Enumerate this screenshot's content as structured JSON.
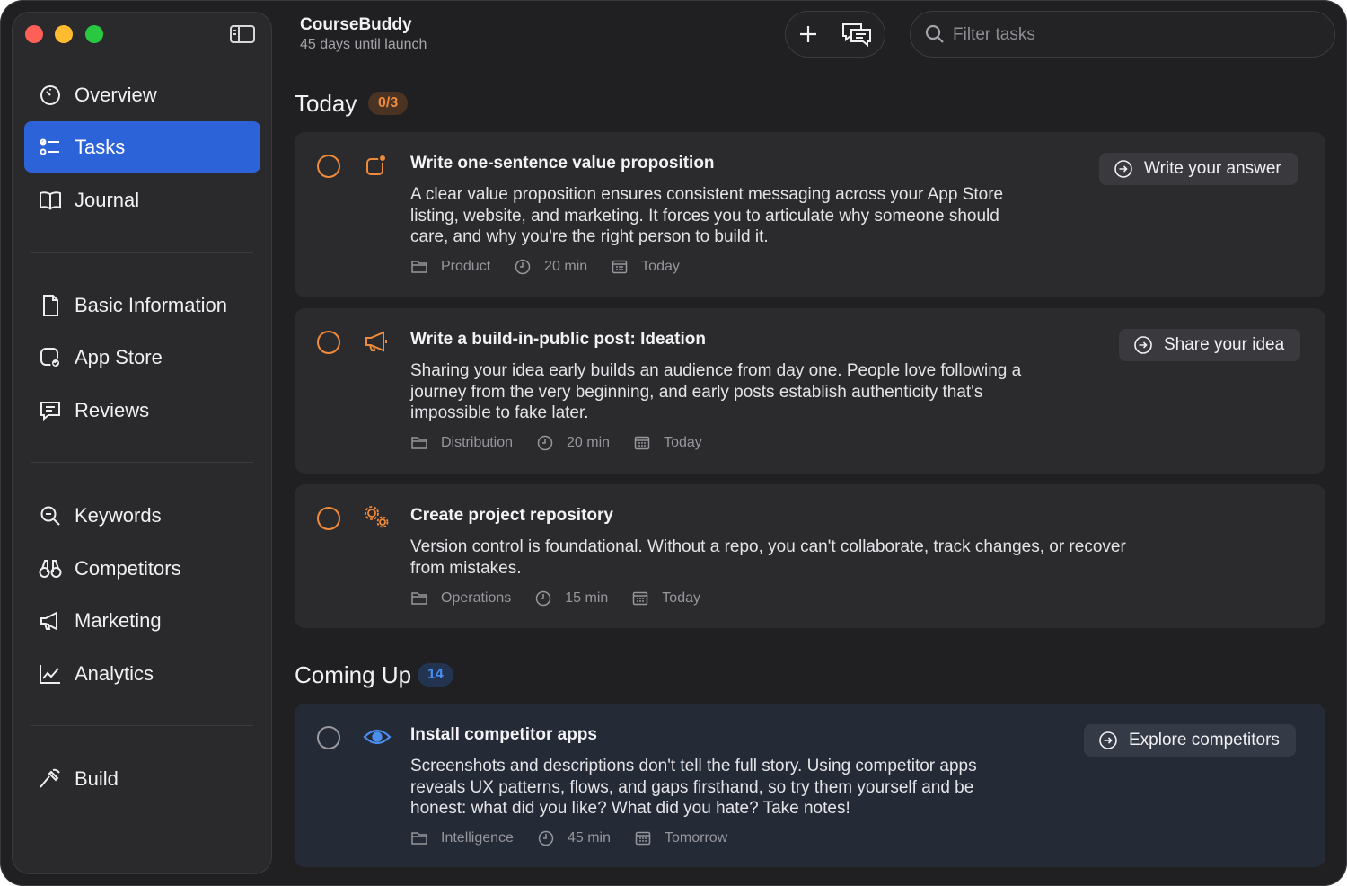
{
  "app": {
    "title": "CourseBuddy",
    "subtitle": "45 days until launch"
  },
  "search": {
    "placeholder": "Filter tasks"
  },
  "sidebar": {
    "items": [
      {
        "label": "Overview",
        "icon": "gauge-icon",
        "active": false
      },
      {
        "label": "Tasks",
        "icon": "checklist-icon",
        "active": true
      },
      {
        "label": "Journal",
        "icon": "book-icon",
        "active": false
      },
      {
        "label": "Basic Information",
        "icon": "document-icon",
        "active": false
      },
      {
        "label": "App Store",
        "icon": "app-store-icon",
        "active": false
      },
      {
        "label": "Reviews",
        "icon": "message-icon",
        "active": false
      },
      {
        "label": "Keywords",
        "icon": "magnifier-icon",
        "active": false
      },
      {
        "label": "Competitors",
        "icon": "binoculars-icon",
        "active": false
      },
      {
        "label": "Marketing",
        "icon": "megaphone-icon",
        "active": false
      },
      {
        "label": "Analytics",
        "icon": "chart-icon",
        "active": false
      },
      {
        "label": "Build",
        "icon": "hammer-icon",
        "active": false
      }
    ]
  },
  "sections": {
    "today": {
      "title": "Today",
      "count": "0/3"
    },
    "coming_up": {
      "title": "Coming Up",
      "count": "14"
    }
  },
  "tasks": [
    {
      "title": "Write one-sentence value proposition",
      "desc": [
        "A clear value proposition ensures consistent messaging across your App Store",
        "listing, website, and marketing. It forces you to articulate why someone should",
        "care, and why you're the right person to build it."
      ],
      "category": "Product",
      "duration": "20 min",
      "due": "Today",
      "action": "Write your answer",
      "icon": "app-badge-icon"
    },
    {
      "title": "Write a build-in-public post: Ideation",
      "desc": [
        "Sharing your idea early builds an audience from day one. People love following a",
        "journey from the very beginning, and early posts establish authenticity that's",
        "impossible to fake later."
      ],
      "category": "Distribution",
      "duration": "20 min",
      "due": "Today",
      "action": "Share your idea",
      "icon": "megaphone-icon"
    },
    {
      "title": "Create project repository",
      "desc": [
        "Version control is foundational. Without a repo, you can't collaborate, track changes, or recover",
        "from mistakes."
      ],
      "category": "Operations",
      "duration": "15 min",
      "due": "Today",
      "action": "",
      "icon": "gears-icon"
    },
    {
      "title": "Install competitor apps",
      "desc": [
        "Screenshots and descriptions don't tell the full story. Using competitor apps",
        "reveals UX patterns, flows, and gaps firsthand, so try them yourself and be",
        "honest: what did you like? What did you hate? Take notes!"
      ],
      "category": "Intelligence",
      "duration": "45 min",
      "due": "Tomorrow",
      "action": "Explore competitors",
      "icon": "eye-icon"
    }
  ],
  "colors": {
    "accent": "#2d63d9",
    "orange": "#ee8a3a",
    "blue_icon": "#4a8ef0"
  }
}
